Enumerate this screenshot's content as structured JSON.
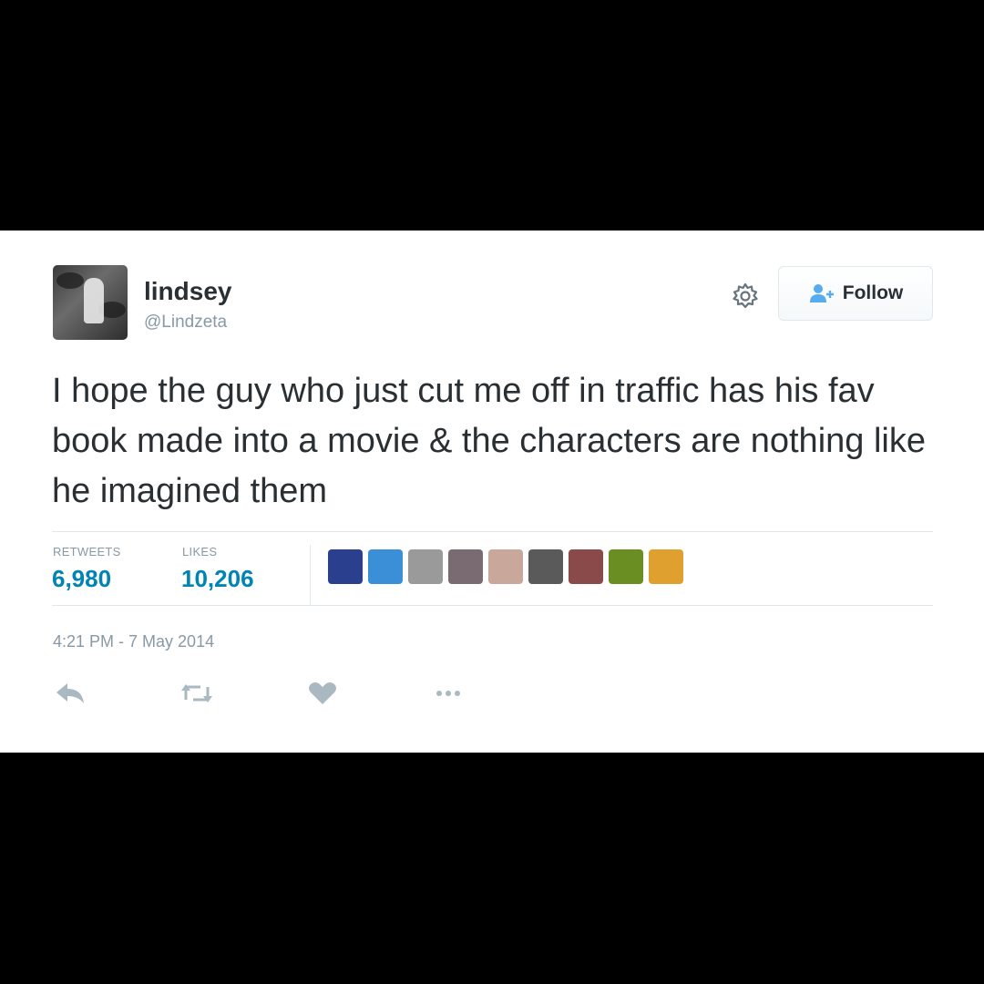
{
  "user": {
    "name": "lindsey",
    "handle": "@Lindzeta"
  },
  "follow_button": {
    "label": "Follow"
  },
  "tweet": {
    "text": "I hope the guy who just cut me off in traffic has his fav book made into a movie & the characters are nothing like he imagined them"
  },
  "stats": {
    "retweets_label": "RETWEETS",
    "retweets_value": "6,980",
    "likes_label": "LIKES",
    "likes_value": "10,206"
  },
  "likers": [
    {
      "icon": "liker-avatar",
      "color": "#2b3f8f"
    },
    {
      "icon": "liker-avatar",
      "color": "#3b8fd6"
    },
    {
      "icon": "liker-avatar",
      "color": "#9a9a9a"
    },
    {
      "icon": "liker-avatar",
      "color": "#7a6a72"
    },
    {
      "icon": "liker-avatar",
      "color": "#c9a79a"
    },
    {
      "icon": "liker-avatar",
      "color": "#5a5a5a"
    },
    {
      "icon": "liker-avatar",
      "color": "#8a4a4a"
    },
    {
      "icon": "liker-avatar",
      "color": "#6b8e23"
    },
    {
      "icon": "liker-avatar",
      "color": "#e0a030"
    }
  ],
  "timestamp": "4:21 PM - 7 May 2014",
  "actions": [
    "reply-icon",
    "retweet-icon",
    "like-icon",
    "more-icon"
  ],
  "colors": {
    "text": "#292f33",
    "muted": "#8899a6",
    "accent": "#0084b4",
    "border": "#e1e8ed"
  }
}
